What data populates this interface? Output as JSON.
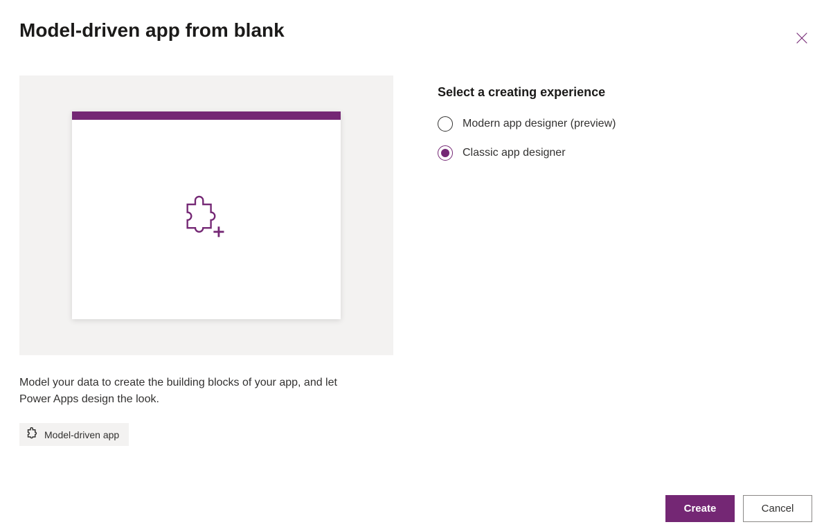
{
  "header": {
    "title": "Model-driven app from blank"
  },
  "left": {
    "description": "Model your data to create the building blocks of your app, and let Power Apps design the look.",
    "tag_label": "Model-driven app"
  },
  "right": {
    "section_title": "Select a creating experience",
    "options": [
      {
        "label": "Modern app designer (preview)",
        "selected": false
      },
      {
        "label": "Classic app designer",
        "selected": true
      }
    ]
  },
  "footer": {
    "create_label": "Create",
    "cancel_label": "Cancel"
  }
}
